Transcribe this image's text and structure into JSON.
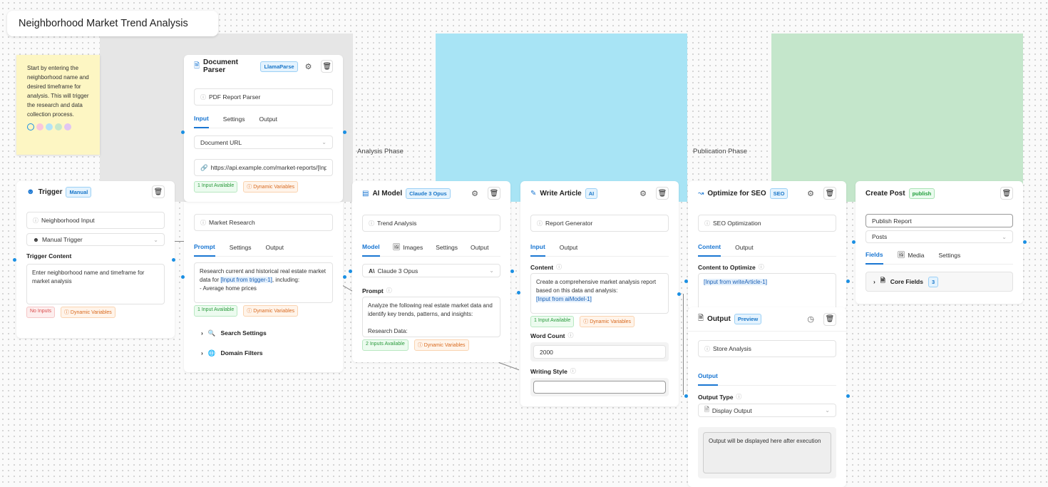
{
  "canvas": {
    "title": "Neighborhood Market Trend Analysis"
  },
  "groups": [
    {
      "label": "",
      "color": "#e6e6e6"
    },
    {
      "label": "Analysis Phase",
      "color": "#a8e4f5"
    },
    {
      "label": "Publication Phase",
      "color": "#c4e6cb"
    }
  ],
  "sticky": {
    "text": "Start by entering the neighborhood name and desired timeframe for analysis. This will trigger the research and data collection process.",
    "colors": [
      "#fdf6c3",
      "#f9c6dc",
      "#b3e3f7",
      "#c6e8cc",
      "#e2c6f2"
    ]
  },
  "trigger": {
    "title": "Trigger",
    "badge": "Manual",
    "name": "Neighborhood Input",
    "type": "Manual Trigger",
    "content_label": "Trigger Content",
    "content": "Enter neighborhood name and timeframe for market analysis",
    "chips": [
      "No Inputs",
      "Dynamic Variables"
    ]
  },
  "doc_parser": {
    "title": "Document Parser",
    "badge": "LlamaParse",
    "name": "PDF Report Parser",
    "tabs": [
      "Input",
      "Settings",
      "Output"
    ],
    "source": "Document URL",
    "url": "https://api.example.com/market-reports/[Input",
    "chips": [
      "1 Input Available",
      "Dynamic Variables"
    ]
  },
  "research": {
    "name": "Market Research",
    "tabs": [
      "Prompt",
      "Settings",
      "Output"
    ],
    "prompt_pre": "Research current and historical real estate market data for ",
    "prompt_var": "[Input from trigger-1]",
    "prompt_post": ", including:\n- Average home prices",
    "chips": [
      "1 Input Available",
      "Dynamic Variables"
    ],
    "sections": [
      "Search Settings",
      "Domain Filters"
    ]
  },
  "ai_model": {
    "title": "AI Model",
    "badge": "Claude 3 Opus",
    "name": "Trend Analysis",
    "tabs": [
      "Model",
      "Images",
      "Settings",
      "Output"
    ],
    "model": "Claude 3 Opus",
    "prompt_label": "Prompt",
    "prompt": "Analyze the following real estate market data and identify key trends, patterns, and insights:\n\nResearch Data:",
    "chips": [
      "2 Inputs Available",
      "Dynamic Variables"
    ]
  },
  "write_article": {
    "title": "Write Article",
    "badge": "AI",
    "name": "Report Generator",
    "tabs": [
      "Input",
      "Output"
    ],
    "content_label": "Content",
    "content": "Create a comprehensive market analysis report based on this data and analysis:",
    "content_var": "[Input from aiModel-1]",
    "chips": [
      "1 Input Available",
      "Dynamic Variables"
    ],
    "word_count_label": "Word Count",
    "word_count": "2000",
    "style_label": "Writing Style",
    "style": ""
  },
  "seo": {
    "title": "Optimize for SEO",
    "badge": "SEO",
    "name": "SEO Optimization",
    "tabs": [
      "Content",
      "Output"
    ],
    "content_label": "Content to Optimize",
    "content_var": "[Input from writeArticle-1]"
  },
  "output": {
    "title": "Output",
    "badge": "Preview",
    "name": "Store Analysis",
    "tabs": [
      "Output"
    ],
    "type_label": "Output Type",
    "type": "Display Output",
    "placeholder": "Output will be displayed here after execution"
  },
  "create_post": {
    "title": "Create Post",
    "badge": "publish",
    "name": "Publish Report",
    "collection": "Posts",
    "tabs": [
      "Fields",
      "Media",
      "Settings"
    ],
    "section": "Core Fields",
    "section_count": "3"
  },
  "accent": "#1976d2"
}
